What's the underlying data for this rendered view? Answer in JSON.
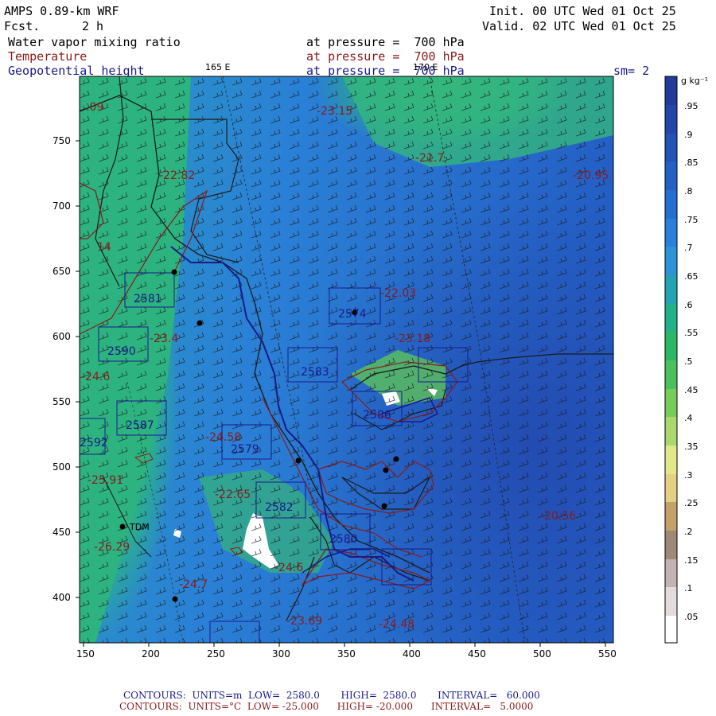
{
  "header": {
    "model": "AMPS 0.89-km WRF",
    "fcst_label": "Fcst.",
    "fcst_value": "2 h",
    "init": "Init. 00 UTC Wed 01 Oct 25",
    "valid": "Valid. 02 UTC Wed 01 Oct 25",
    "field1": "Water vapor mixing ratio",
    "field2": "Temperature",
    "field3": "Geopotential height",
    "pressure1": "at pressure =  700 hPa",
    "pressure2": "at pressure =  700 hPa",
    "pressure3": "at pressure =  700 hPa",
    "lon165": "165 E",
    "lon170": "170 E",
    "sm": "sm= 2"
  },
  "colorbar": {
    "unit": "g kg⁻¹",
    "labels": [
      ".95",
      ".9",
      ".85",
      ".8",
      ".75",
      ".7",
      ".65",
      ".6",
      ".55",
      ".5",
      ".45",
      ".4",
      ".35",
      ".3",
      ".25",
      ".2",
      ".15",
      ".1",
      ".05"
    ],
    "colors": [
      "#233a9a",
      "#2446a8",
      "#2452b8",
      "#2460c6",
      "#2470d2",
      "#2a80dc",
      "#2e92d6",
      "#24a4b2",
      "#22b28a",
      "#2ab866",
      "#4cc05c",
      "#78cc5a",
      "#a8d86e",
      "#e2e888",
      "#e4d084",
      "#c4a06a",
      "#a08878",
      "#c2b4b4",
      "#e4dcdc",
      "#ffffff"
    ]
  },
  "axes": {
    "x_ticks": [
      "150",
      "200",
      "250",
      "300",
      "350",
      "400",
      "450",
      "500",
      "550"
    ],
    "y_ticks": [
      "750",
      "700",
      "650",
      "600",
      "550",
      "500",
      "450",
      "400"
    ]
  },
  "map_labels": {
    "temp": [
      "-23.15",
      "-21.7",
      "-22.82",
      "-20.95",
      "-22.03",
      "-23.4",
      "-23.18",
      "-24.6",
      "-24.58",
      "-25.91",
      "-22.65",
      "-20.56",
      "-26.29",
      "-24.7",
      "-24.6",
      "-23.69",
      "-24.48"
    ],
    "height": [
      "2581",
      "2574",
      "2590",
      "2583",
      "2587",
      "2579",
      "2592",
      "2582",
      "2580",
      "2586"
    ],
    "station": "TDM",
    "fragments": [
      ".09",
      "14"
    ]
  },
  "footer": {
    "line1": "CONTOURS:  UNITS=m  LOW=  2580.0       HIGH=  2580.0       INTERVAL=   60.000",
    "line2": "CONTOURS:  UNITS=°C  LOW= -25.000      HIGH= -20.000      INTERVAL=   5.0000"
  }
}
